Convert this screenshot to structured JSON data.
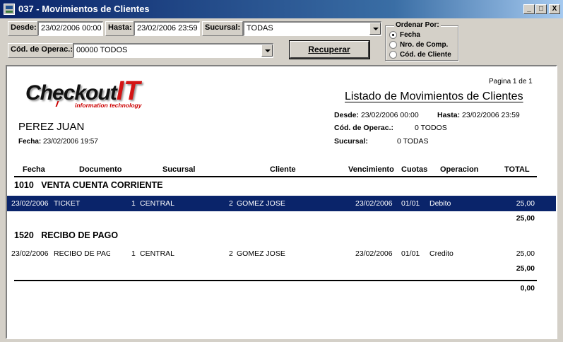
{
  "window": {
    "title": "037 - Movimientos de Clientes",
    "buttons": {
      "minimize": "_",
      "maximize": "□",
      "close": "X"
    }
  },
  "filters": {
    "desde_label": "Desde:",
    "desde_value": "23/02/2006 00:00",
    "hasta_label": "Hasta:",
    "hasta_value": "23/02/2006 23:59",
    "sucursal_label": "Sucursal:",
    "sucursal_value": "TODAS",
    "operac_label": "Cód. de Operac.:",
    "operac_value": "00000 TODOS",
    "recuperar_label": "Recuperar"
  },
  "order": {
    "title": "Ordenar Por:",
    "options": [
      {
        "label": "Fecha",
        "selected": true
      },
      {
        "label": "Nro. de Comp.",
        "selected": false
      },
      {
        "label": "Cód. de Cliente",
        "selected": false
      }
    ]
  },
  "report": {
    "logo": {
      "main": "Checkout",
      "accent": "IT",
      "tagline": "information technology"
    },
    "page_info": "Pagina 1 de 1",
    "title": "Listado de Movimientos de Clientes",
    "meta": {
      "desde_label": "Desde:",
      "desde_value": "23/02/2006 00:00",
      "hasta_label": "Hasta:",
      "hasta_value": "23/02/2006 23:59",
      "operac_label": "Cód. de Operac.:",
      "operac_value": "0 TODOS",
      "sucursal_label": "Sucursal:",
      "sucursal_value": "0 TODAS"
    },
    "user": "PEREZ JUAN",
    "fecha_label": "Fecha:",
    "fecha_value": "23/02/2006 19:57",
    "columns": {
      "fecha": "Fecha",
      "documento": "Documento",
      "sucursal": "Sucursal",
      "cliente": "Cliente",
      "vencimiento": "Vencimiento",
      "cuotas": "Cuotas",
      "operacion": "Operacion",
      "total": "TOTAL"
    },
    "groups": [
      {
        "code": "1010",
        "name": "VENTA CUENTA CORRIENTE",
        "row": {
          "fecha": "23/02/2006",
          "documento": "TICKET",
          "suc_num": "1",
          "sucursal": "CENTRAL",
          "cli_num": "2",
          "cliente": "GOMEZ JOSE",
          "vencimiento": "23/02/2006",
          "cuotas": "01/01",
          "operacion": "Debito",
          "total": "25,00"
        },
        "subtotal": "25,00"
      },
      {
        "code": "1520",
        "name": "RECIBO DE PAGO",
        "row": {
          "fecha": "23/02/2006",
          "documento": "RECIBO DE PAG",
          "suc_num": "1",
          "sucursal": "CENTRAL",
          "cli_num": "2",
          "cliente": "GOMEZ JOSE",
          "vencimiento": "23/02/2006",
          "cuotas": "01/01",
          "operacion": "Credito",
          "total": "25,00"
        },
        "subtotal": "25,00"
      }
    ],
    "grand_total": "0,00"
  }
}
